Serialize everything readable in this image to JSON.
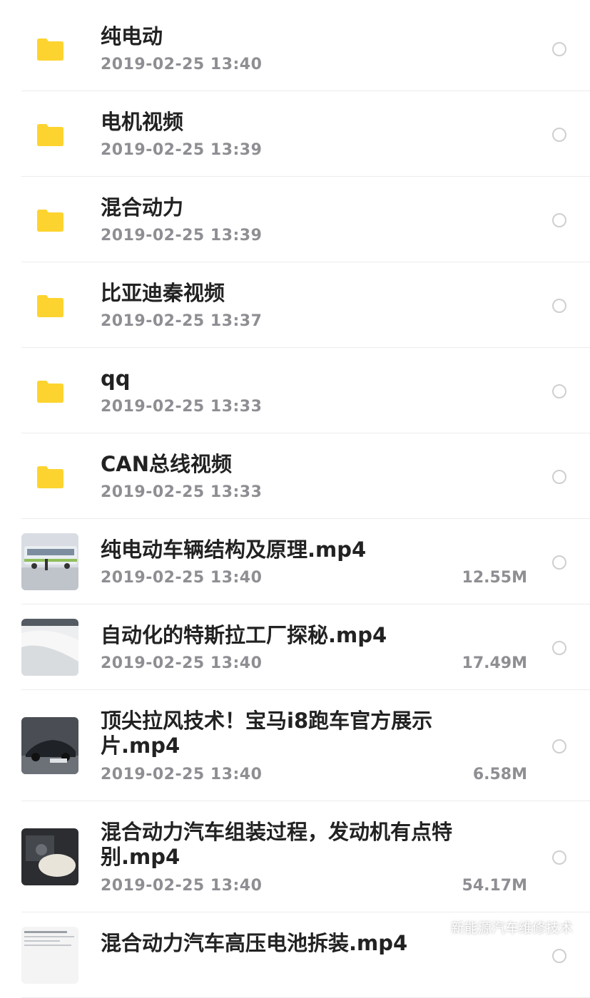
{
  "folders": [
    {
      "name": "纯电动",
      "date": "2019-02-25 13:40"
    },
    {
      "name": "电机视频",
      "date": "2019-02-25 13:39"
    },
    {
      "name": "混合动力",
      "date": "2019-02-25 13:39"
    },
    {
      "name": "比亚迪秦视频",
      "date": "2019-02-25 13:37"
    },
    {
      "name": "qq",
      "date": "2019-02-25 13:33"
    },
    {
      "name": "CAN总线视频",
      "date": "2019-02-25 13:33"
    }
  ],
  "videos": [
    {
      "name": "纯电动车辆结构及原理.mp4",
      "date": "2019-02-25 13:40",
      "size": "12.55M",
      "thumb": "bus-thumbnail"
    },
    {
      "name": "自动化的特斯拉工厂探秘.mp4",
      "date": "2019-02-25 13:40",
      "size": "17.49M",
      "thumb": "factory-thumbnail"
    },
    {
      "name": "顶尖拉风技术！宝马i8跑车官方展示片.mp4",
      "date": "2019-02-25 13:40",
      "size": "6.58M",
      "thumb": "bmw-i8-thumbnail"
    },
    {
      "name": "混合动力汽车组装过程，发动机有点特别.mp4",
      "date": "2019-02-25 13:40",
      "size": "54.17M",
      "thumb": "engine-thumbnail"
    },
    {
      "name": "混合动力汽车高压电池拆装.mp4",
      "date": "",
      "size": "",
      "thumb": "document-thumbnail"
    }
  ],
  "watermark": {
    "text": "新能源汽车维修技术",
    "icon": "wechat-icon"
  },
  "colors": {
    "folder": "#fdd42f",
    "text": "#222222",
    "secondary": "#8e8e93"
  }
}
